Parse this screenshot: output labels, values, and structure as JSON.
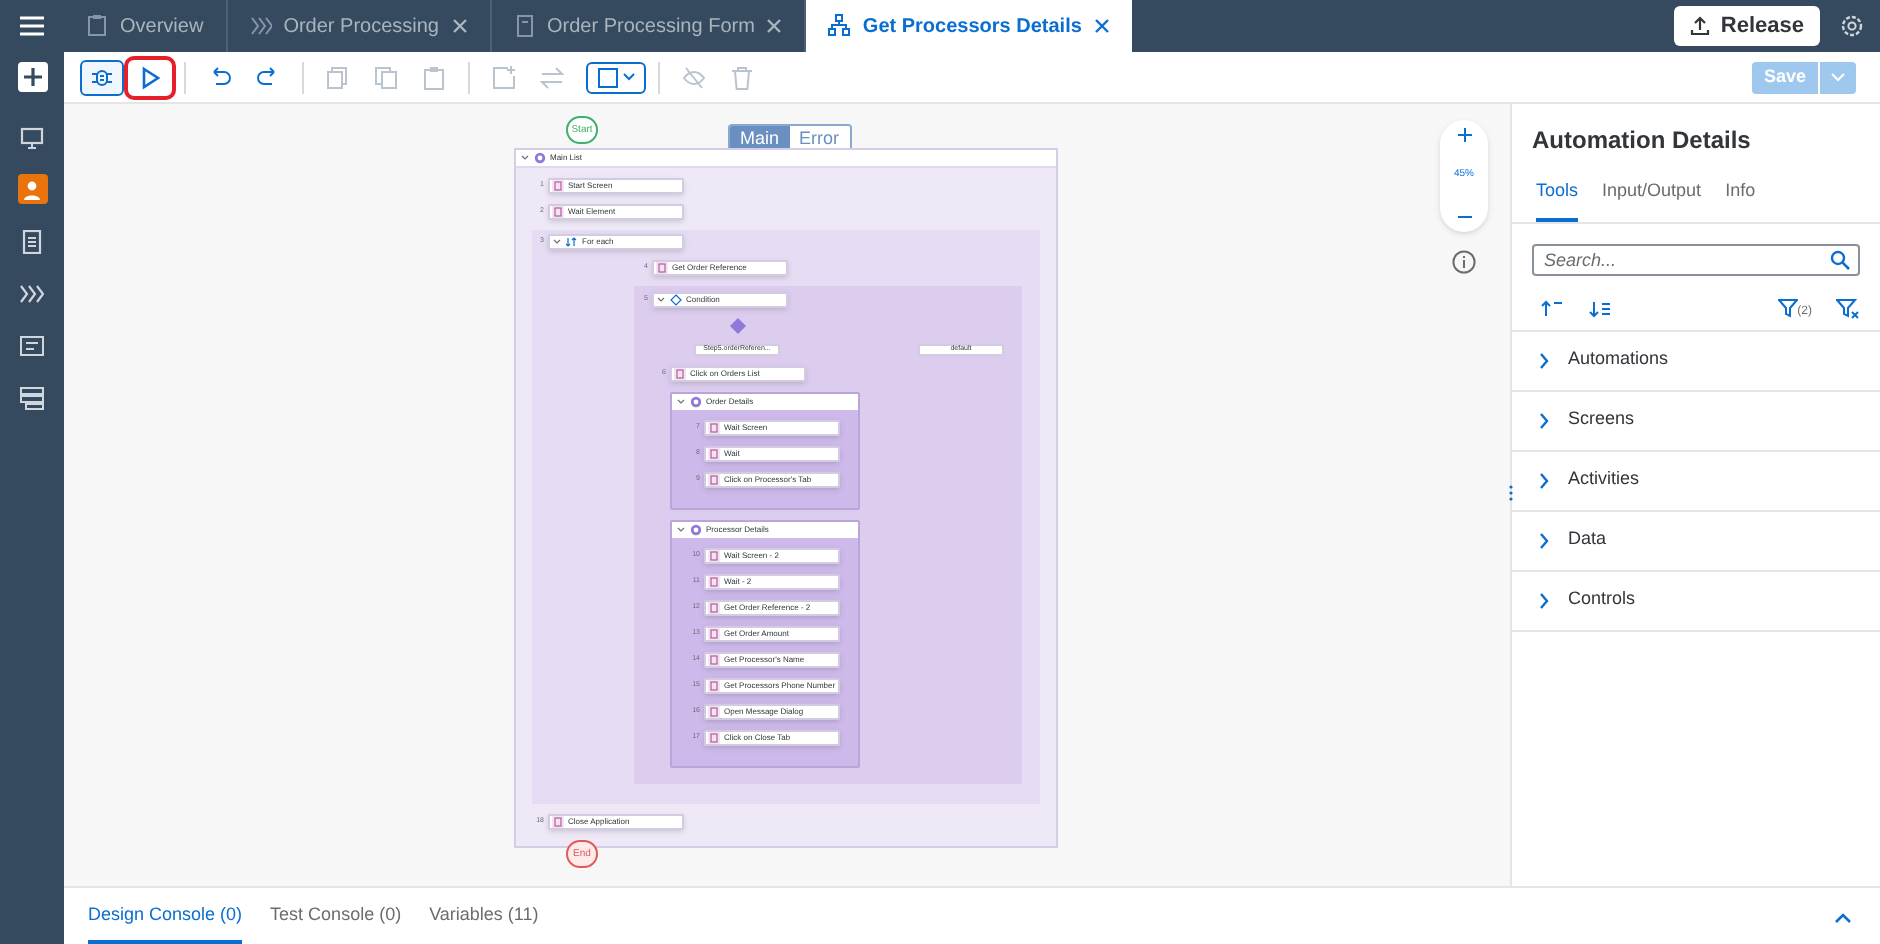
{
  "tabs": [
    {
      "kind": "clipboard",
      "label": "Overview",
      "closable": false,
      "selected": false
    },
    {
      "kind": "chevrons",
      "label": "Order Processing",
      "closable": true,
      "selected": false
    },
    {
      "kind": "form",
      "label": "Order Processing Form",
      "closable": true,
      "selected": false
    },
    {
      "kind": "flow",
      "label": "Get Processors Details",
      "closable": true,
      "selected": true
    }
  ],
  "release_button": "Release",
  "sidebar_items": [
    {
      "kind": "monitor",
      "selected": false
    },
    {
      "kind": "person",
      "selected": true
    },
    {
      "kind": "document",
      "selected": false
    },
    {
      "kind": "chevrons",
      "selected": false
    },
    {
      "kind": "list",
      "selected": false
    },
    {
      "kind": "tree",
      "selected": false
    }
  ],
  "toolbar": [
    {
      "kind": "debug",
      "disabled": false,
      "highlighted": false
    },
    {
      "kind": "run",
      "disabled": false,
      "highlighted": true
    },
    {
      "kind": "undo",
      "disabled": false,
      "highlighted": false
    },
    {
      "kind": "redo",
      "disabled": false,
      "highlighted": false
    },
    {
      "kind": "copy",
      "disabled": true,
      "highlighted": false
    },
    {
      "kind": "cut",
      "disabled": true,
      "highlighted": false
    },
    {
      "kind": "paste",
      "disabled": true,
      "highlighted": false
    },
    {
      "kind": "add-frame",
      "disabled": true,
      "highlighted": false
    },
    {
      "kind": "swap",
      "disabled": true,
      "highlighted": false
    },
    {
      "kind": "select",
      "disabled": false,
      "highlighted": false
    },
    {
      "kind": "hide",
      "disabled": true,
      "highlighted": false
    },
    {
      "kind": "delete",
      "disabled": true,
      "highlighted": false
    }
  ],
  "save_button": {
    "label": "Save",
    "disabled": true
  },
  "canvas": {
    "modes": [
      {
        "label": "Main",
        "selected": true
      },
      {
        "label": "Error",
        "selected": false
      }
    ],
    "zoom": "45%",
    "start_label": "Start",
    "end_label": "End",
    "flow": {
      "kind": "list",
      "label": "Main List",
      "children": [
        {
          "kind": "step",
          "number": "1",
          "label": "Start Screen"
        },
        {
          "kind": "step",
          "number": "2",
          "label": "Wait Element"
        },
        {
          "kind": "loop",
          "number": "3",
          "label": "For each",
          "children": [
            {
              "kind": "step",
              "number": "4",
              "label": "Get Order Reference"
            },
            {
              "kind": "condition",
              "number": "5",
              "label": "Condition",
              "branches": [
                {
                  "label": "Step5.orderReferen...",
                  "children": [
                    {
                      "kind": "step",
                      "number": "6",
                      "label": "Click on Orders List"
                    },
                    {
                      "kind": "group",
                      "label": "Order Details",
                      "children": [
                        {
                          "kind": "step",
                          "number": "7",
                          "label": "Wait Screen"
                        },
                        {
                          "kind": "step",
                          "number": "8",
                          "label": "Wait"
                        },
                        {
                          "kind": "step",
                          "number": "9",
                          "label": "Click on Processor's Tab"
                        }
                      ]
                    },
                    {
                      "kind": "group",
                      "label": "Processor Details",
                      "children": [
                        {
                          "kind": "step",
                          "number": "10",
                          "label": "Wait Screen - 2"
                        },
                        {
                          "kind": "step",
                          "number": "11",
                          "label": "Wait - 2"
                        },
                        {
                          "kind": "step",
                          "number": "12",
                          "label": "Get Order Reference - 2"
                        },
                        {
                          "kind": "step",
                          "number": "13",
                          "label": "Get Order Amount"
                        },
                        {
                          "kind": "step",
                          "number": "14",
                          "label": "Get Processor's Name"
                        },
                        {
                          "kind": "step",
                          "number": "15",
                          "label": "Get Processors Phone Number"
                        },
                        {
                          "kind": "step",
                          "number": "16",
                          "label": "Open Message Dialog"
                        },
                        {
                          "kind": "step",
                          "number": "17",
                          "label": "Click on Close Tab"
                        }
                      ]
                    }
                  ]
                },
                {
                  "label": "default"
                }
              ]
            }
          ]
        },
        {
          "kind": "step",
          "number": "18",
          "label": "Close Application"
        }
      ]
    }
  },
  "details": {
    "title": "Automation Details",
    "tabs": [
      {
        "label": "Tools",
        "selected": true
      },
      {
        "label": "Input/Output",
        "selected": false
      },
      {
        "label": "Info",
        "selected": false
      }
    ],
    "search": {
      "placeholder": "Search..."
    },
    "filter_count": "(2)",
    "categories": [
      {
        "label": "Automations",
        "expanded": false
      },
      {
        "label": "Screens",
        "expanded": false
      },
      {
        "label": "Activities",
        "expanded": false
      },
      {
        "label": "Data",
        "expanded": false
      },
      {
        "label": "Controls",
        "expanded": false
      }
    ]
  },
  "console_tabs": [
    {
      "label": "Design Console (0)",
      "selected": true
    },
    {
      "label": "Test Console (0)",
      "selected": false
    },
    {
      "label": "Variables (11)",
      "selected": false
    }
  ]
}
